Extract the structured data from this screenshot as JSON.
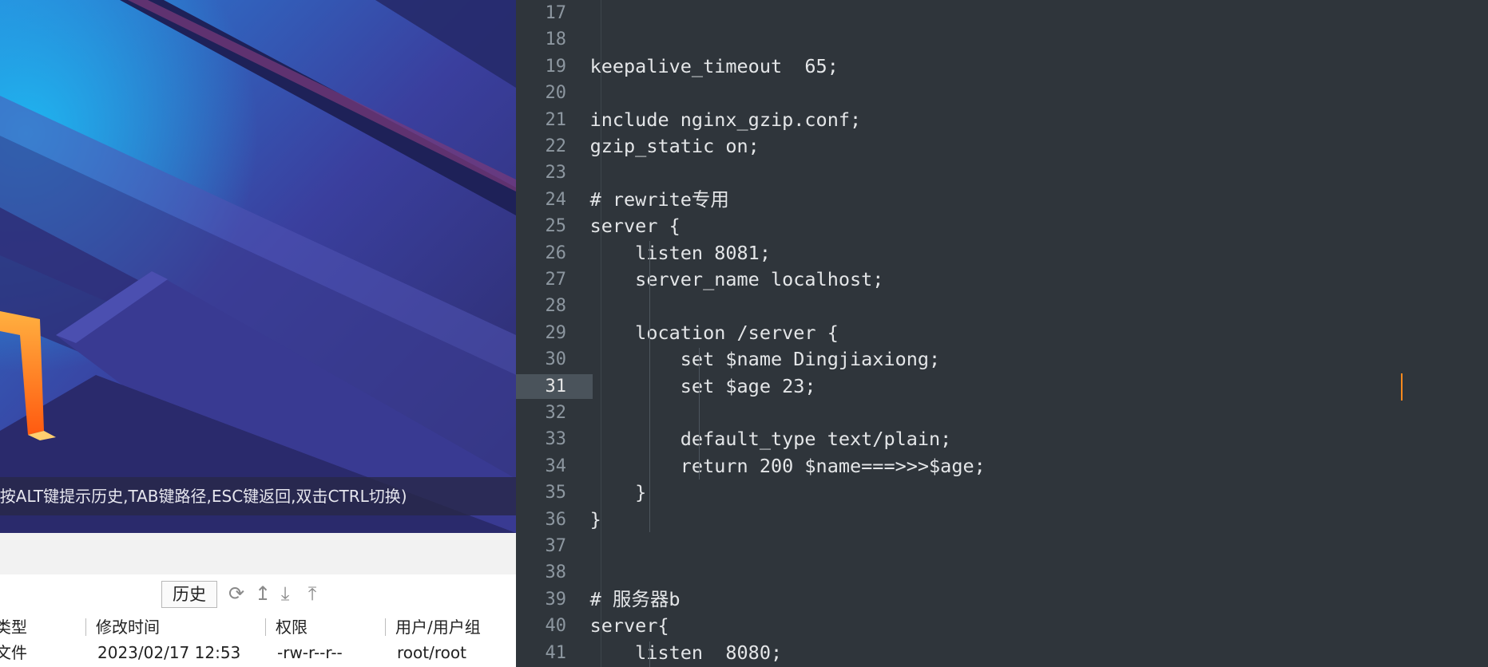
{
  "left_panel": {
    "hint_text": "(按ALT键提示历史,TAB键路径,ESC键返回,双击CTRL切换)",
    "toolbar": {
      "history_label": "历史",
      "icons": [
        "refresh-icon",
        "up-icon",
        "download-icon",
        "upload-icon"
      ]
    },
    "file_table": {
      "columns": [
        "类型",
        "修改时间",
        "权限",
        "用户/用户组"
      ],
      "rows": [
        {
          "type": "文件",
          "modified": "2023/02/17 12:53",
          "permissions": "-rw-r--r--",
          "owner": "root/root"
        }
      ]
    }
  },
  "editor": {
    "active_line": 31,
    "lines": [
      {
        "n": "17",
        "t": ""
      },
      {
        "n": "18",
        "t": ""
      },
      {
        "n": "19",
        "t": "    keepalive_timeout  65;"
      },
      {
        "n": "20",
        "t": ""
      },
      {
        "n": "21",
        "t": "    include nginx_gzip.conf;"
      },
      {
        "n": "22",
        "t": "    gzip_static on;"
      },
      {
        "n": "23",
        "t": ""
      },
      {
        "n": "24",
        "t": "    # rewrite专用"
      },
      {
        "n": "25",
        "t": "    server {"
      },
      {
        "n": "26",
        "t": "        listen 8081;"
      },
      {
        "n": "27",
        "t": "        server_name localhost;"
      },
      {
        "n": "28",
        "t": ""
      },
      {
        "n": "29",
        "t": "        location /server {"
      },
      {
        "n": "30",
        "t": "            set $name Dingjiaxiong;"
      },
      {
        "n": "31",
        "t": "            set $age 23;"
      },
      {
        "n": "32",
        "t": ""
      },
      {
        "n": "33",
        "t": "            default_type text/plain;"
      },
      {
        "n": "34",
        "t": "            return 200 $name===>>>$age;"
      },
      {
        "n": "35",
        "t": "        }"
      },
      {
        "n": "36",
        "t": "    }"
      },
      {
        "n": "37",
        "t": ""
      },
      {
        "n": "38",
        "t": ""
      },
      {
        "n": "39",
        "t": "    # 服务器b"
      },
      {
        "n": "40",
        "t": "    server{"
      },
      {
        "n": "41",
        "t": "        listen  8080;"
      }
    ]
  }
}
